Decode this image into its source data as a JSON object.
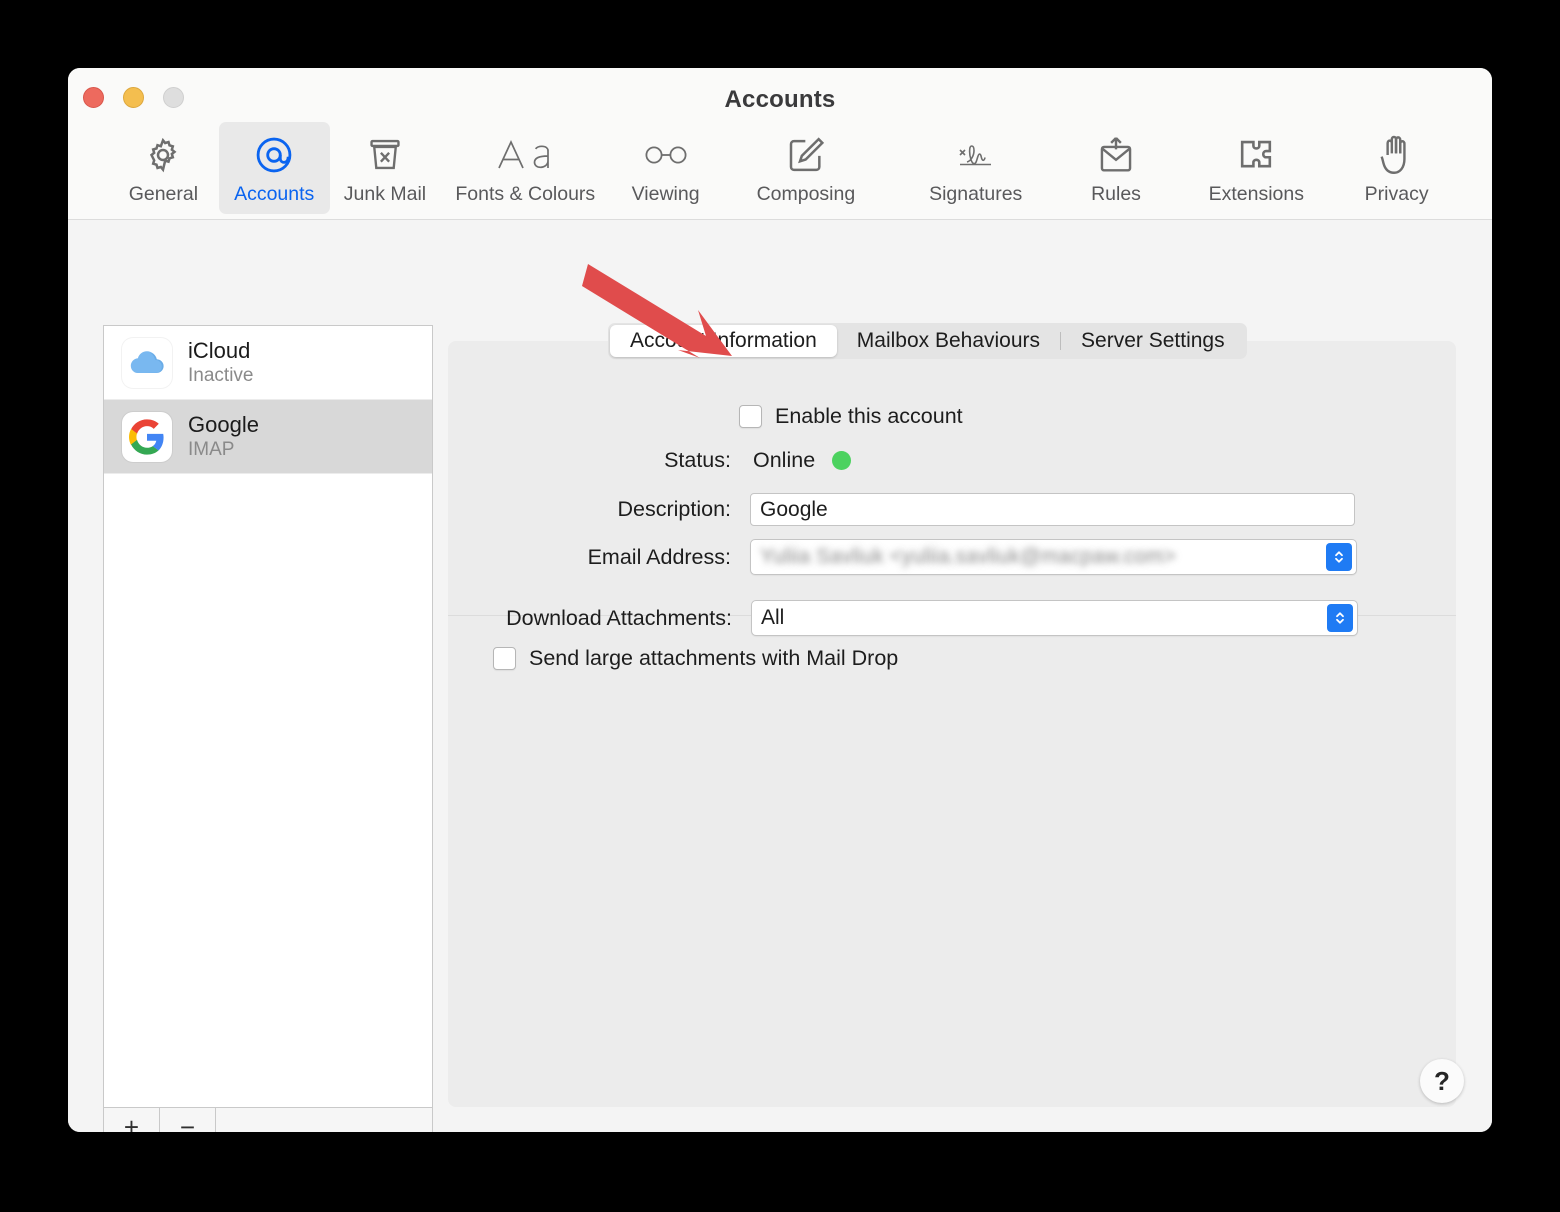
{
  "window": {
    "title": "Accounts",
    "traffic_lights": [
      {
        "name": "close",
        "color": "#ed6a5e"
      },
      {
        "name": "minimize",
        "color": "#f4be4f"
      },
      {
        "name": "zoom",
        "color": "#dedede"
      }
    ]
  },
  "toolbar": {
    "items": [
      {
        "id": "general",
        "label": "General",
        "icon": "gear-icon",
        "selected": false
      },
      {
        "id": "accounts",
        "label": "Accounts",
        "icon": "at-sign-icon",
        "selected": true
      },
      {
        "id": "junk-mail",
        "label": "Junk Mail",
        "icon": "junk-bin-icon",
        "selected": false
      },
      {
        "id": "fonts-colours",
        "label": "Fonts & Colours",
        "icon": "aa-text-icon",
        "selected": false
      },
      {
        "id": "viewing",
        "label": "Viewing",
        "icon": "glasses-icon",
        "selected": false
      },
      {
        "id": "composing",
        "label": "Composing",
        "icon": "compose-pen-icon",
        "selected": false
      },
      {
        "id": "signatures",
        "label": "Signatures",
        "icon": "signature-icon",
        "selected": false
      },
      {
        "id": "rules",
        "label": "Rules",
        "icon": "rules-mail-icon",
        "selected": false
      },
      {
        "id": "extensions",
        "label": "Extensions",
        "icon": "puzzle-icon",
        "selected": false
      },
      {
        "id": "privacy",
        "label": "Privacy",
        "icon": "hand-icon",
        "selected": false
      }
    ],
    "accent_color": "#0a64f0",
    "selected_bg": "#e9e9e9"
  },
  "sidebar": {
    "accounts": [
      {
        "name": "iCloud",
        "type": "Inactive",
        "icon": "icloud-icon",
        "selected": false
      },
      {
        "name": "Google",
        "type": "IMAP",
        "icon": "google-g-icon",
        "selected": true
      }
    ],
    "add_label": "+",
    "remove_label": "−"
  },
  "tabs": [
    {
      "label": "Account Information",
      "active": true
    },
    {
      "label": "Mailbox Behaviours",
      "active": false
    },
    {
      "label": "Server Settings",
      "active": false
    }
  ],
  "form": {
    "enable_account": {
      "label": "Enable this account",
      "checked": false
    },
    "status": {
      "label": "Status:",
      "value": "Online",
      "indicator_color": "#4cd25f"
    },
    "description": {
      "label": "Description:",
      "value": "Google"
    },
    "email_address": {
      "label": "Email Address:",
      "value": "Yuliia Savliuk <yuliia.savliuk@macpaw.com>",
      "redacted": true
    },
    "download_attachments": {
      "label": "Download Attachments:",
      "value": "All"
    },
    "mail_drop": {
      "label": "Send large attachments with Mail Drop",
      "checked": false
    }
  },
  "help": {
    "label": "?"
  },
  "annotation": {
    "type": "arrow",
    "color": "#e04c4c",
    "points_at": "enable-this-account-checkbox"
  }
}
